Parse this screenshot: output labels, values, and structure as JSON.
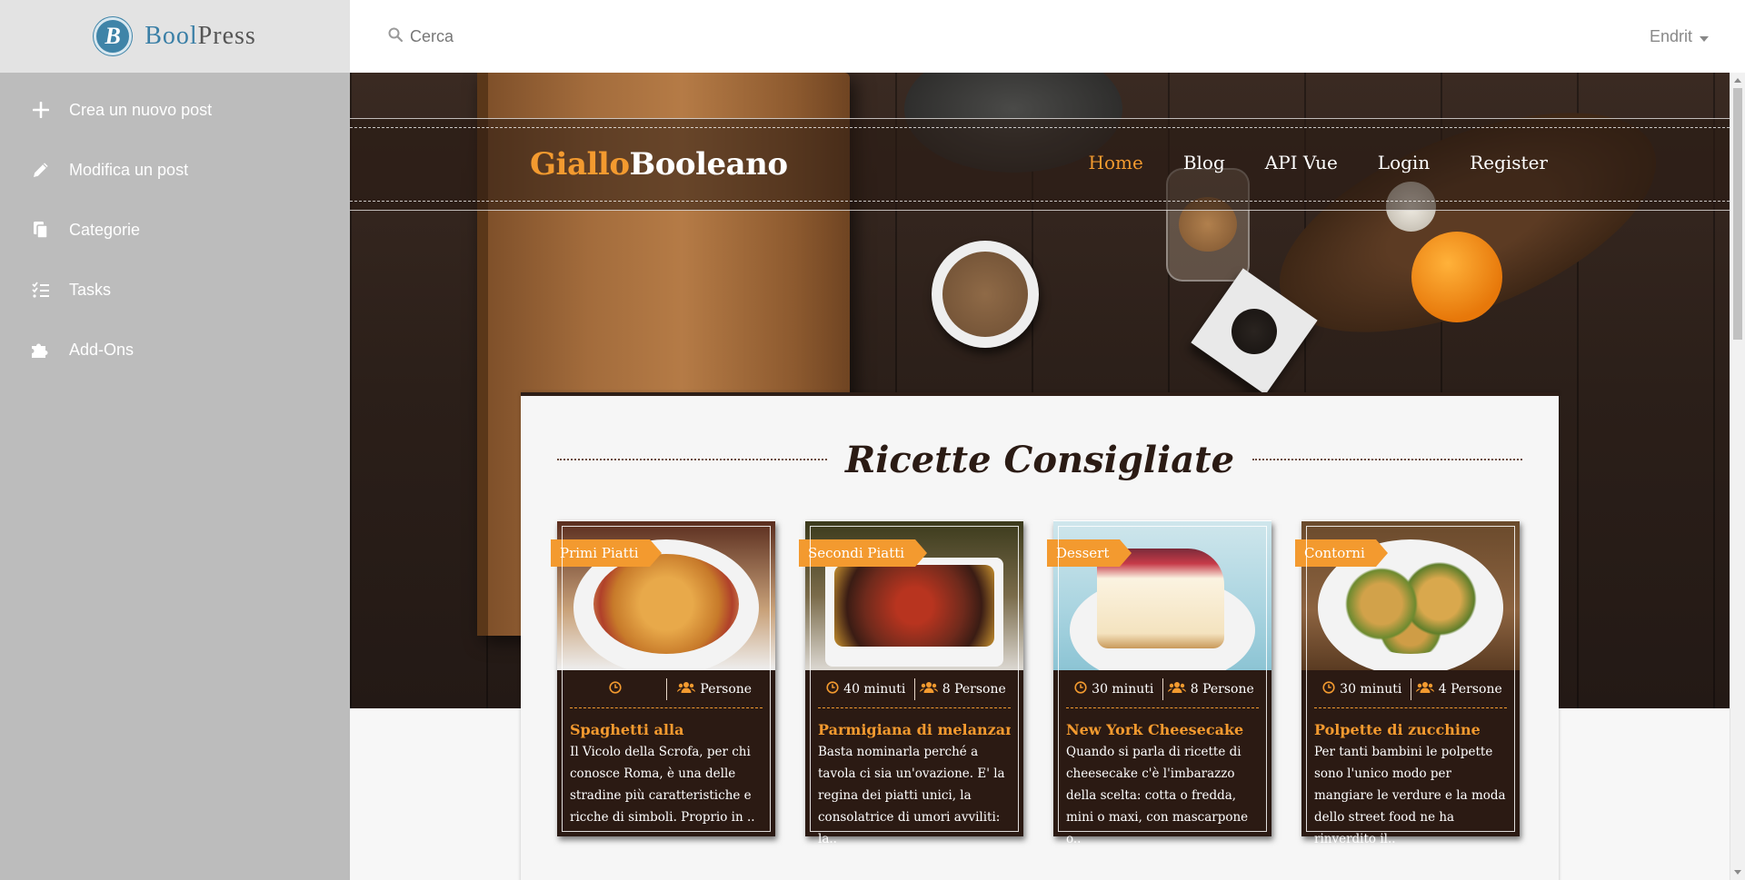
{
  "admin": {
    "brand": {
      "part1": "Bool",
      "part2": "Press",
      "logo_letter": "B"
    },
    "sidebar": {
      "items": [
        {
          "label": "Crea un nuovo post",
          "icon": "plus-icon"
        },
        {
          "label": "Modifica un post",
          "icon": "pencil-icon"
        },
        {
          "label": "Categorie",
          "icon": "copy-icon"
        },
        {
          "label": "Tasks",
          "icon": "tasks-icon"
        },
        {
          "label": "Add-Ons",
          "icon": "puzzle-icon"
        }
      ]
    },
    "search": {
      "placeholder": "Cerca"
    },
    "user": {
      "name": "Endrit"
    }
  },
  "site": {
    "logo": {
      "part1": "Giallo",
      "part2": "Booleano"
    },
    "nav": [
      {
        "label": "Home",
        "active": true
      },
      {
        "label": "Blog",
        "active": false
      },
      {
        "label": "API Vue",
        "active": false
      },
      {
        "label": "Login",
        "active": false
      },
      {
        "label": "Register",
        "active": false
      }
    ],
    "section_title": "Ricette Consigliate",
    "colors": {
      "accent": "#f39a2f",
      "dark": "#2b1a13"
    },
    "cards": [
      {
        "category": "Primi Piatti",
        "time": "",
        "people": "Persone",
        "title": "Spaghetti alla",
        "text": "Il Vicolo della Scrofa, per chi conosce Roma, è una delle stradine più caratteristiche e ricche di simboli. Proprio in .."
      },
      {
        "category": "Secondi Piatti",
        "time": "40 minuti",
        "people": "8 Persone",
        "title": "Parmigiana di melanzane",
        "text": "Basta nominarla perché a tavola ci sia un'ovazione. E' la regina dei piatti unici, la consolatrice di umori avviliti: la.."
      },
      {
        "category": "Dessert",
        "time": "30 minuti",
        "people": "8 Persone",
        "title": "New York Cheesecake",
        "text": "Quando si parla di ricette di cheesecake c'è l'imbarazzo della scelta: cotta o fredda, mini o maxi, con mascarpone o.."
      },
      {
        "category": "Contorni",
        "time": "30 minuti",
        "people": "4 Persone",
        "title": "Polpette di zucchine",
        "text": "Per tanti bambini le polpette sono l'unico modo per mangiare le verdure e la moda dello street food ne ha rinverdito il.."
      }
    ]
  }
}
